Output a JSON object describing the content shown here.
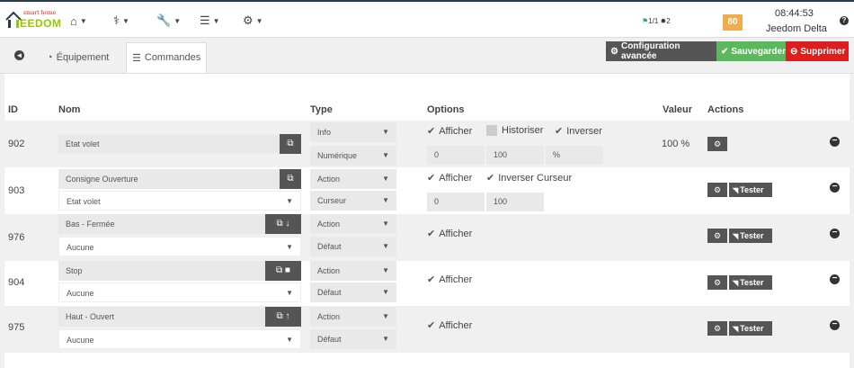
{
  "logo": {
    "text_main": "EEDOM",
    "text_j": "J",
    "tagline": "smart home"
  },
  "nav": {
    "items": [
      {
        "icon": "home-icon",
        "glyph": "⌂"
      },
      {
        "icon": "stethoscope-icon",
        "glyph": "⚕"
      },
      {
        "icon": "wrench-icon",
        "glyph": "🔧"
      },
      {
        "icon": "list-icon",
        "glyph": "☰"
      },
      {
        "icon": "gear-icon",
        "glyph": "⚙"
      }
    ]
  },
  "status": {
    "messages": "1/1",
    "updates": "2",
    "score": "80",
    "time": "08:44:53",
    "user": "Jeedom Delta",
    "help": "?"
  },
  "tabs": {
    "equipment": "Équipement",
    "commands": "Commandes"
  },
  "actions": {
    "config": "Configuration avancée",
    "save": "Sauvegarder",
    "delete": "Supprimer"
  },
  "columns": {
    "id": "ID",
    "name": "Nom",
    "type": "Type",
    "options": "Options",
    "value": "Valeur",
    "actions": "Actions"
  },
  "rows": [
    {
      "id": "902",
      "name": "Etat volet",
      "type": "Info",
      "subtype": "Numérique",
      "opts": {
        "afficher": "Afficher",
        "historiser": "Historiser",
        "inverser": "Inverser"
      },
      "min": "0",
      "max": "100",
      "unit": "%",
      "value": "100 %"
    },
    {
      "id": "903",
      "name": "Consigne Ouverture",
      "linked": "Etat volet",
      "type": "Action",
      "subtype": "Curseur",
      "opts": {
        "afficher": "Afficher",
        "inverser": "Inverser Curseur"
      },
      "min": "0",
      "max": "100",
      "test": "Tester"
    },
    {
      "id": "976",
      "name": "Bas - Fermée",
      "linked": "Aucune",
      "type": "Action",
      "subtype": "Défaut",
      "opts": {
        "afficher": "Afficher"
      },
      "test": "Tester"
    },
    {
      "id": "904",
      "name": "Stop",
      "linked": "Aucune",
      "type": "Action",
      "subtype": "Défaut",
      "opts": {
        "afficher": "Afficher"
      },
      "test": "Tester"
    },
    {
      "id": "975",
      "name": "Haut - Ouvert",
      "linked": "Aucune",
      "type": "Action",
      "subtype": "Défaut",
      "opts": {
        "afficher": "Afficher"
      },
      "test": "Tester"
    }
  ]
}
